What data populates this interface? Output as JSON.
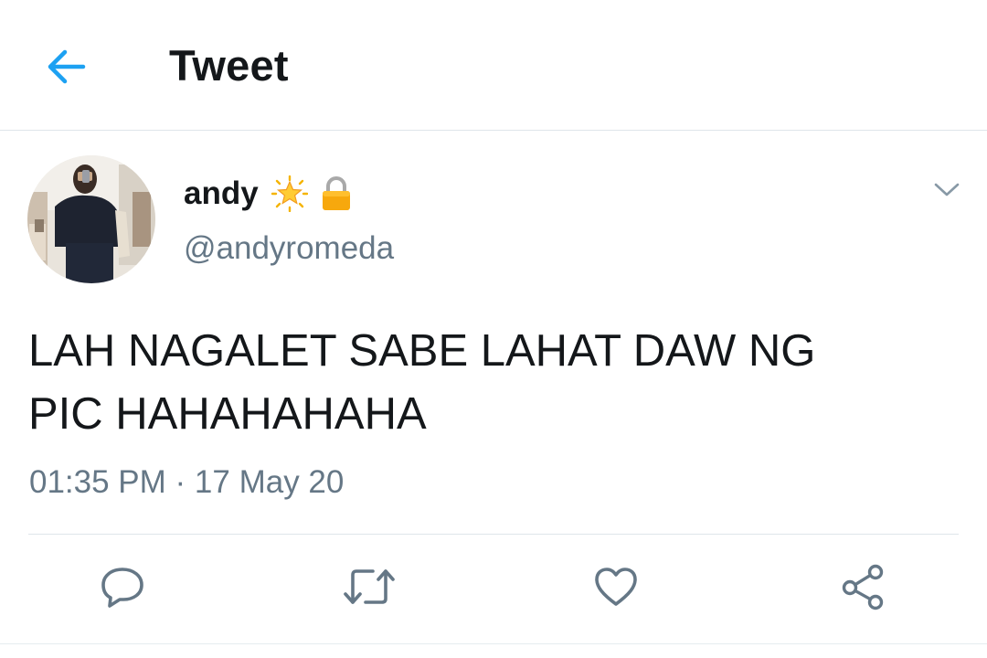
{
  "header": {
    "title": "Tweet",
    "back_icon": "arrow-left-icon",
    "accent_color": "#1da1f2"
  },
  "tweet": {
    "author": {
      "display_name": "andy",
      "handle": "@andyromeda",
      "badges": [
        "glowing-star-emoji",
        "lock-emoji"
      ]
    },
    "text_lines": [
      "LAH NAGALET SABE LAHAT DAW NG",
      "PIC HAHAHAHAHA"
    ],
    "timestamp": "01:35 PM · 17 May 20",
    "menu_icon": "chevron-down-icon"
  },
  "actions": [
    {
      "name": "reply",
      "icon": "reply-icon"
    },
    {
      "name": "retweet",
      "icon": "retweet-icon"
    },
    {
      "name": "like",
      "icon": "heart-icon"
    },
    {
      "name": "share",
      "icon": "share-icon"
    }
  ],
  "colors": {
    "text_primary": "#14171a",
    "text_secondary": "#657786",
    "icon_gray": "#657786",
    "divider": "#dfe5ea"
  }
}
